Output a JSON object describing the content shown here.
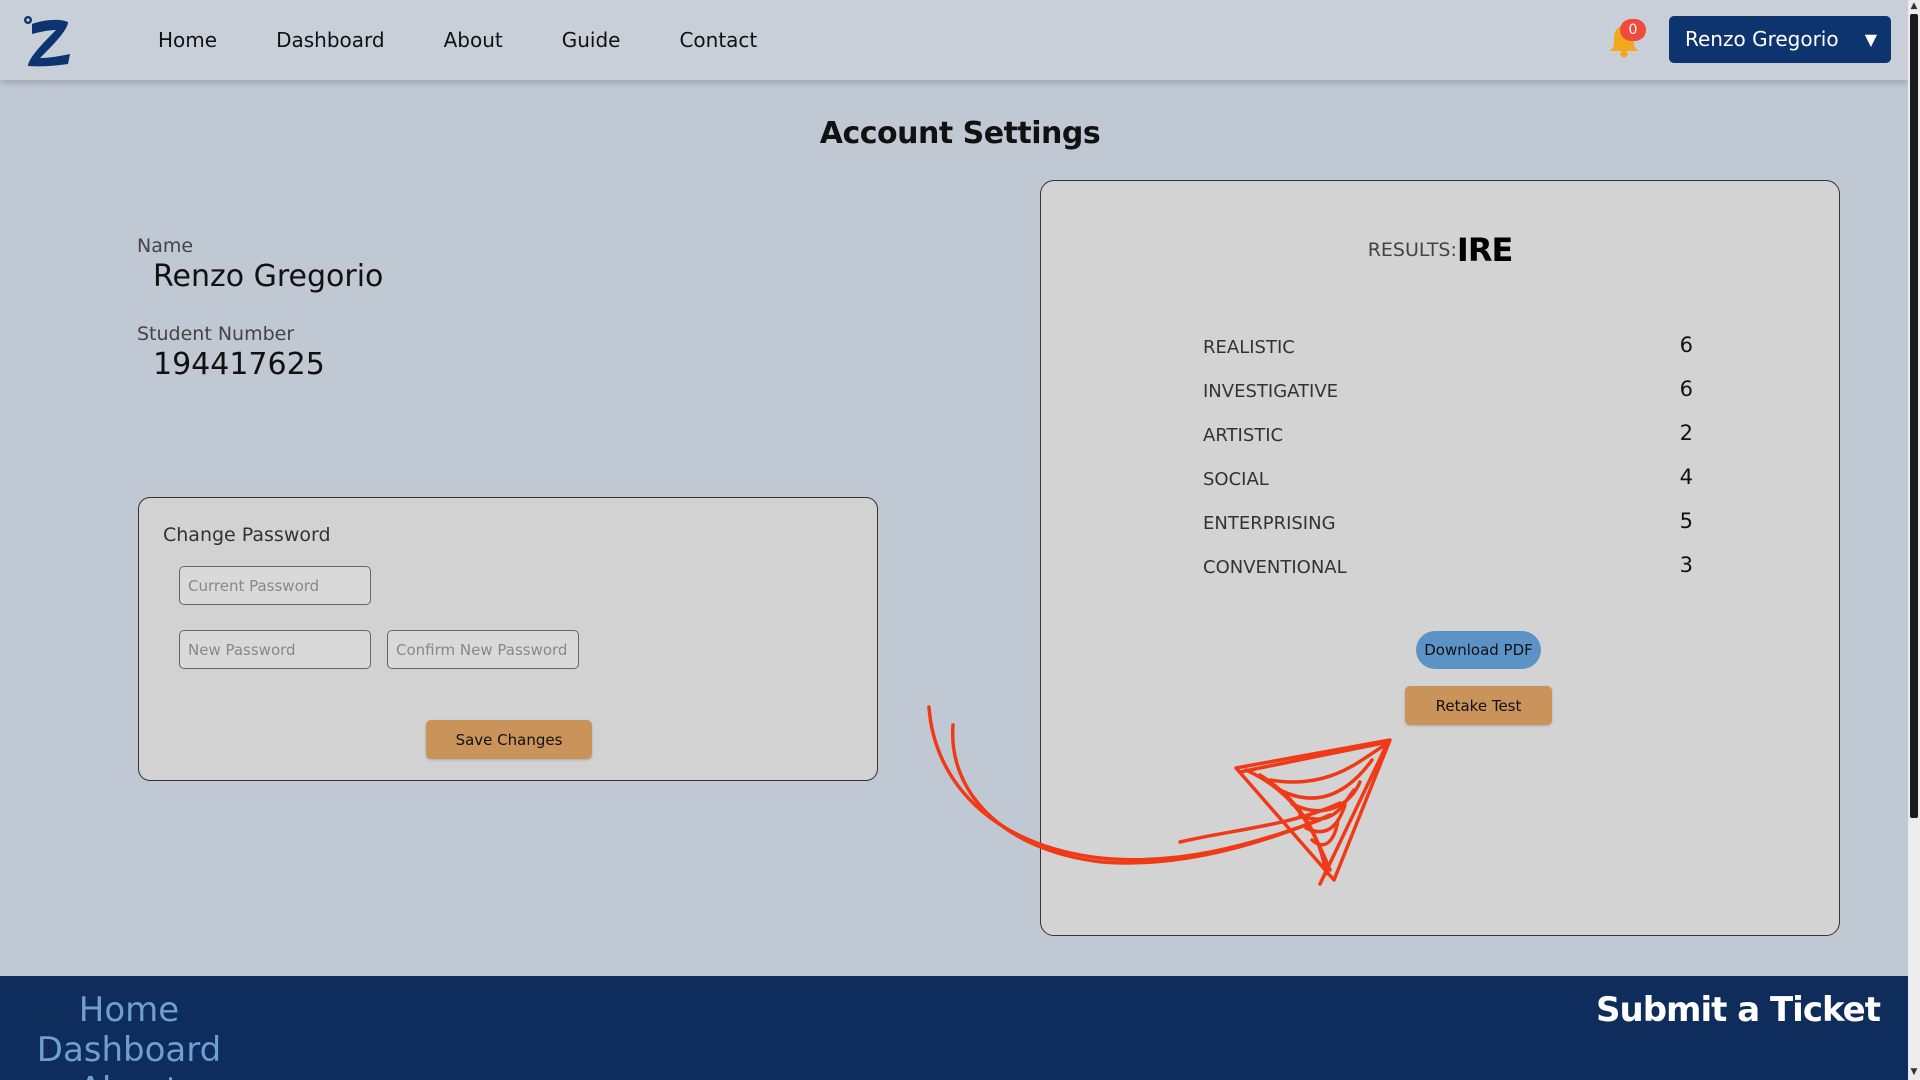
{
  "nav": {
    "items": [
      "Home",
      "Dashboard",
      "About",
      "Guide",
      "Contact"
    ],
    "notification_count": "0",
    "user_name": "Renzo Gregorio",
    "caret": "▼"
  },
  "page": {
    "title": "Account Settings"
  },
  "profile": {
    "name_label": "Name",
    "name_value": "Renzo Gregorio",
    "student_number_label": "Student Number",
    "student_number_value": "194417625"
  },
  "password": {
    "title": "Change Password",
    "current_placeholder": "Current Password",
    "new_placeholder": "New Password",
    "confirm_placeholder": "Confirm New Password",
    "save_label": "Save Changes"
  },
  "results": {
    "label": "RESULTS:",
    "code": "IRE",
    "scores": [
      {
        "name": "REALISTIC",
        "value": "6"
      },
      {
        "name": "INVESTIGATIVE",
        "value": "6"
      },
      {
        "name": "ARTISTIC",
        "value": "2"
      },
      {
        "name": "SOCIAL",
        "value": "4"
      },
      {
        "name": "ENTERPRISING",
        "value": "5"
      },
      {
        "name": "CONVENTIONAL",
        "value": "3"
      }
    ],
    "download_label": "Download PDF",
    "retake_label": "Retake Test"
  },
  "footer": {
    "links": [
      "Home",
      "Dashboard",
      "About"
    ],
    "ticket_label": "Submit a Ticket"
  },
  "colors": {
    "brand_navy": "#0e3470",
    "accent_orange": "#c9935a",
    "accent_blue": "#5b93c6",
    "annotation_red": "#f03a17"
  }
}
